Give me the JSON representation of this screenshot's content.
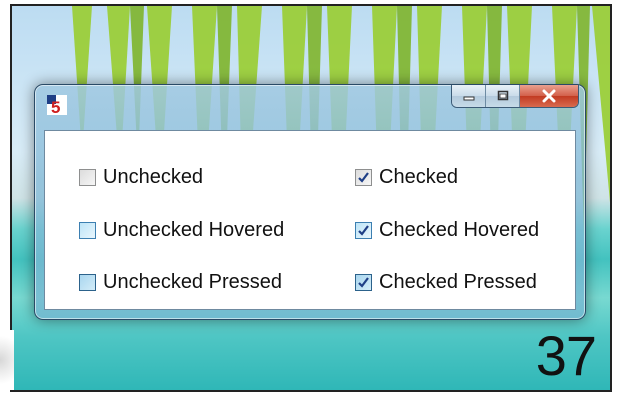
{
  "page": {
    "number": "37"
  },
  "window": {
    "icon": "app-5-icon",
    "caption_buttons": {
      "minimize_icon": "minimize-icon",
      "maximize_icon": "restore-icon",
      "close_icon": "close-icon"
    }
  },
  "checkboxes": {
    "left": [
      {
        "label": "Unchecked",
        "checked": false,
        "state": "normal"
      },
      {
        "label": "Unchecked Hovered",
        "checked": false,
        "state": "hovered"
      },
      {
        "label": "Unchecked Pressed",
        "checked": false,
        "state": "pressed"
      }
    ],
    "right": [
      {
        "label": "Checked",
        "checked": true,
        "state": "normal"
      },
      {
        "label": "Checked Hovered",
        "checked": true,
        "state": "hovered"
      },
      {
        "label": "Checked Pressed",
        "checked": true,
        "state": "pressed"
      }
    ]
  },
  "colors": {
    "check_mark": "#1f3f86",
    "close_button": "#c23b22",
    "window_frame": "#a0c8e1"
  }
}
